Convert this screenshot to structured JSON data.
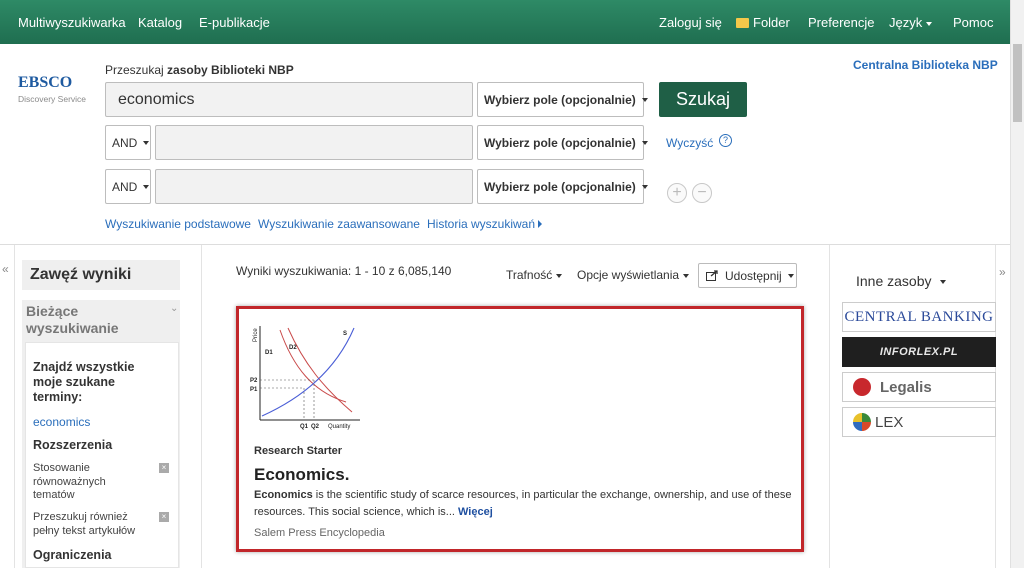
{
  "topnav": {
    "left": [
      "Multiwyszukiwarka",
      "Katalog",
      "E-publikacje"
    ],
    "login": "Zaloguj się",
    "folder": "Folder",
    "preferences": "Preferencje",
    "language": "Język",
    "help": "Pomoc"
  },
  "brand": {
    "logo_text": "EBSCO",
    "logo_sub": "Discovery Service",
    "library_name": "Centralna Biblioteka NBP"
  },
  "search": {
    "label_prefix": "Przeszukaj",
    "label_strong": "zasoby Biblioteki NBP",
    "query": "economics",
    "field_select": "Wybierz pole (opcjonalnie)",
    "operator": "AND",
    "search_button": "Szukaj",
    "clear": "Wyczyść",
    "help_icon": "?",
    "links": [
      "Wyszukiwanie podstawowe",
      "Wyszukiwanie zaawansowane",
      "Historia wyszukiwań"
    ]
  },
  "left_panel": {
    "title": "Zawęź wyniki",
    "current_search": "Bieżące wyszukiwanie",
    "find_all": "Znajdź wszystkie moje szukane terminy:",
    "term": "economics",
    "expanders_title": "Rozszerzenia",
    "expanders": [
      "Stosowanie równoważnych tematów",
      "Przeszukuj również pełny tekst artykułów"
    ],
    "limits_title": "Ograniczenia",
    "collapse_glyph": "«"
  },
  "results": {
    "summary": "Wyniki wyszukiwania: 1 - 10 z 6,085,140",
    "relevance": "Trafność",
    "display_options": "Opcje wyświetlania",
    "share": "Udostępnij",
    "item": {
      "type": "Research Starter",
      "title": "Economics.",
      "snippet_bold": "Economics",
      "snippet_rest": " is the scientific study of scarce resources, in particular the exchange, ownership, and use of these resources. This social science, which is...",
      "more": "Więcej",
      "source": "Salem Press Encyclopedia",
      "graph_labels": {
        "y": "Price",
        "x": "Quantity",
        "s": "S",
        "d1": "D1",
        "d2": "D2",
        "p1": "P1",
        "p2": "P2",
        "q1": "Q1",
        "q2": "Q2"
      }
    }
  },
  "right_panel": {
    "title": "Inne zasoby",
    "expand_glyph": "»",
    "resources": [
      "CENTRAL BANKING",
      "INFORLEX.PL",
      "Legalis",
      "LEX"
    ]
  },
  "colors": {
    "topbar": "#1f6e50",
    "search_button": "#1f5f46",
    "link": "#2a6ebb",
    "highlight_border": "#c1262a"
  }
}
